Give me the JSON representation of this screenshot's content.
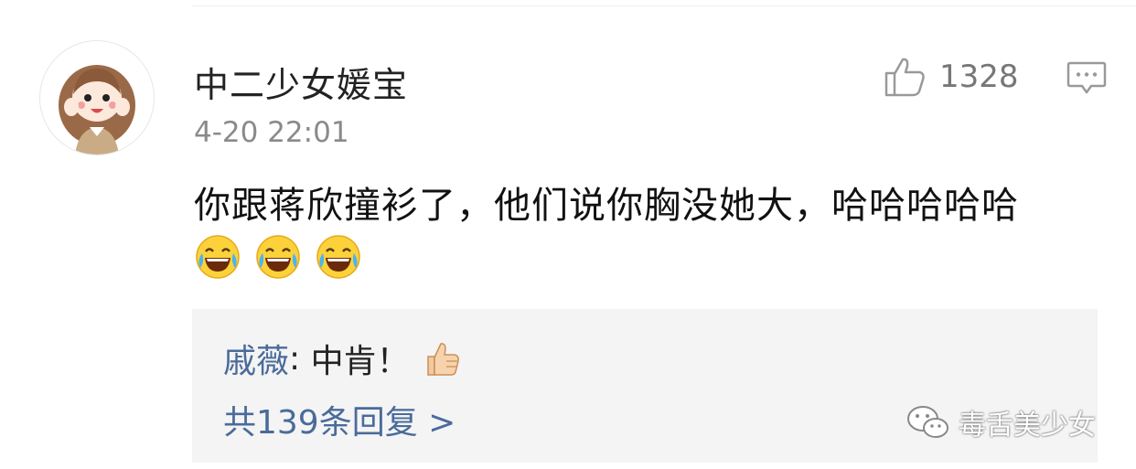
{
  "comment": {
    "username": "中二少女媛宝",
    "timestamp": "4-20 22:01",
    "text": "你跟蒋欣撞衫了，他们说你胸没她大，哈哈哈哈哈",
    "emojis": [
      "laugh-cry-emoji",
      "laugh-cry-emoji",
      "laugh-cry-emoji"
    ],
    "likes": "1328",
    "avatar_icon": "cartoon-girl-avatar",
    "like_icon": "thumb-up-outline-icon",
    "reply_icon": "comment-bubble-icon"
  },
  "reply_preview": {
    "author": "戚薇",
    "separator": ": ",
    "text": "中肯！",
    "emoji": "thumbs-up-emoji",
    "more_replies": "共139条回复 >"
  },
  "watermark": {
    "text": "毒舌美少女",
    "icon": "wechat-icon"
  },
  "colors": {
    "link_blue": "#4a6b9b",
    "reply_bg": "#f4f4f4",
    "meta_gray": "#8a8a8a"
  }
}
